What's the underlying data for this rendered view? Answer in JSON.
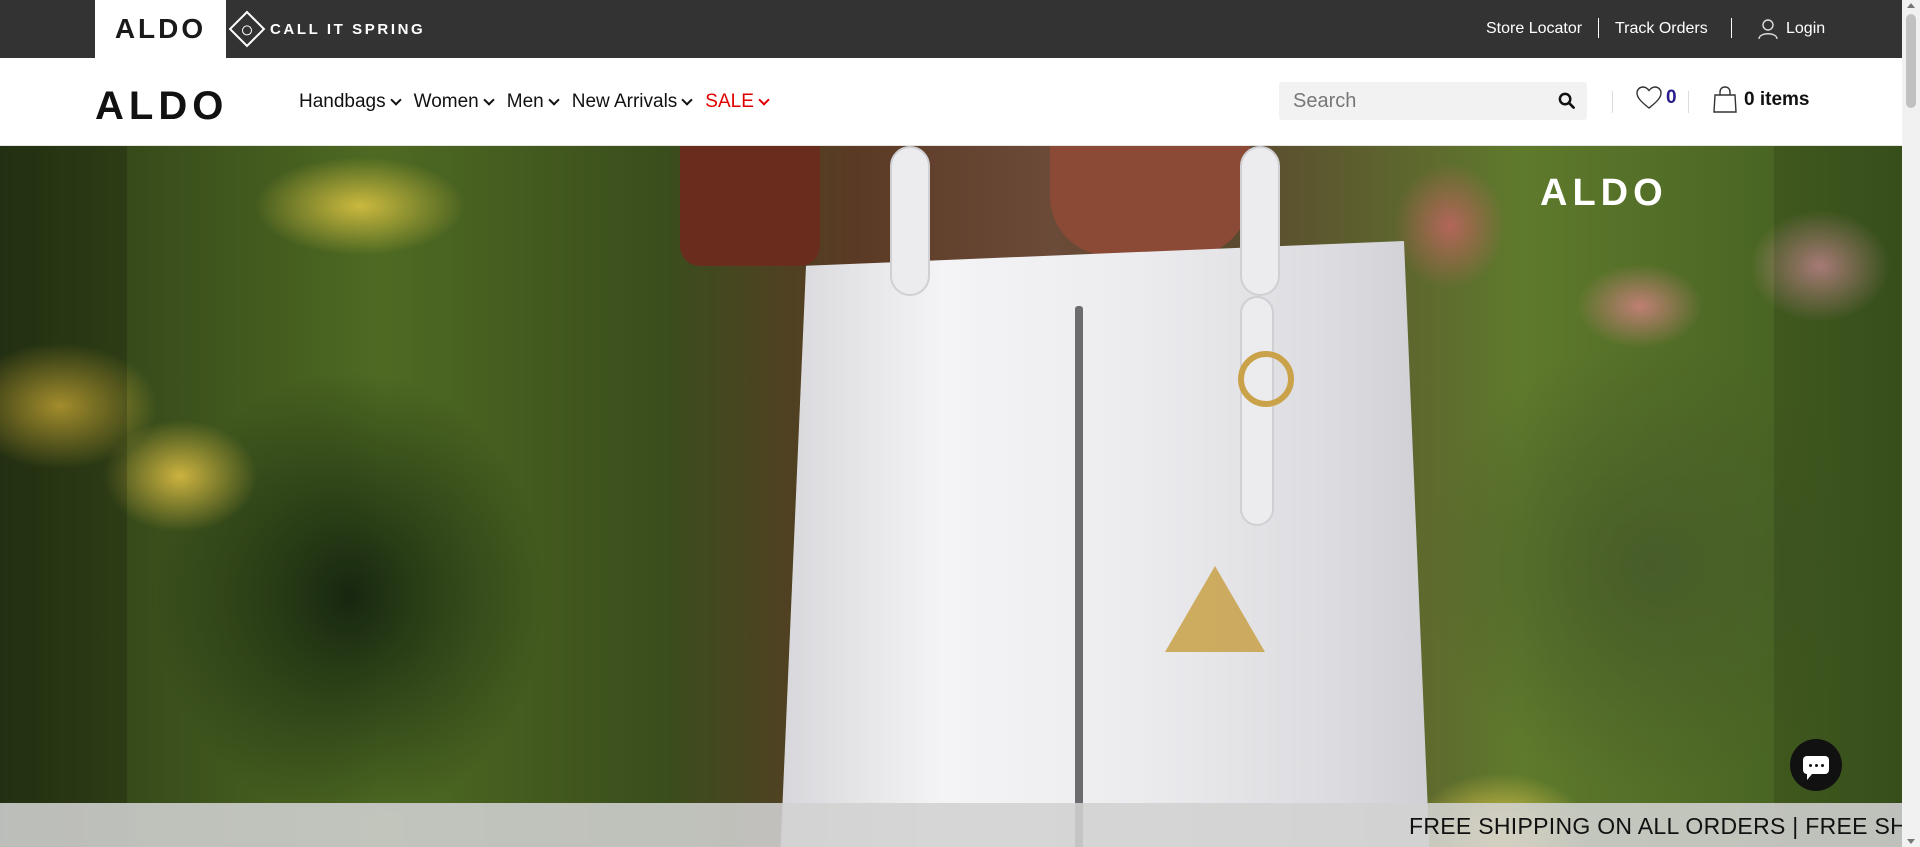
{
  "topbar": {
    "brand_tab": "ALDO",
    "partner": "CALL IT SPRING",
    "store_locator": "Store Locator",
    "track_orders": "Track Orders",
    "login": "Login"
  },
  "nav": {
    "logo": "ALDO",
    "menu": [
      {
        "label": "Handbags"
      },
      {
        "label": "Women"
      },
      {
        "label": "Men"
      },
      {
        "label": "New Arrivals"
      },
      {
        "label": "SALE"
      }
    ],
    "search_placeholder": "Search",
    "wishlist_count": "0",
    "cart_label": "0 items"
  },
  "hero": {
    "overlay_logo": "ALDO"
  },
  "ticker": {
    "text": "FREE SHIPPING ON ALL ORDERS | FREE SHIPPING"
  },
  "colors": {
    "topbar_bg": "#333333",
    "sale": "#e00000",
    "wishlist_count": "#2a1d8c"
  },
  "icons": [
    "aldo-brand-icon",
    "call-it-spring-diamond-icon",
    "user-icon",
    "search-icon",
    "heart-icon",
    "shopping-bag-icon",
    "chat-icon",
    "chevron-down-icon"
  ]
}
